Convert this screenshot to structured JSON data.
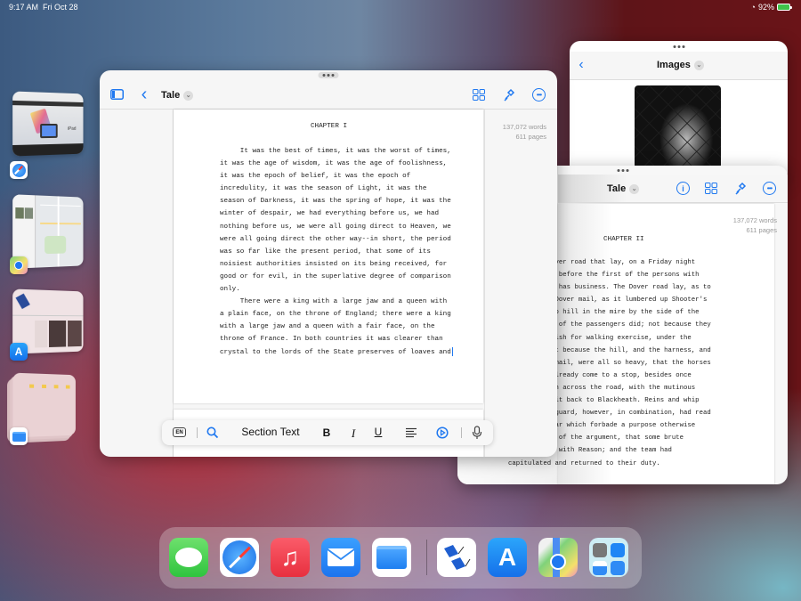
{
  "status_bar": {
    "time": "9:17 AM",
    "date": "Fri Oct 28",
    "wifi_icon": "wifi-icon",
    "battery_percent": "92%",
    "battery_level": 0.92,
    "battery_charging": true
  },
  "app_switcher": [
    {
      "app": "Safari",
      "icon": "safari-icon",
      "thumb_caption": "iPad"
    },
    {
      "app": "Maps",
      "icon": "maps-icon"
    },
    {
      "app": "App Store",
      "icon": "app-store-icon"
    },
    {
      "app": "Files",
      "icon": "files-icon"
    }
  ],
  "main_window": {
    "title": "Tale",
    "toolbar_icons": [
      "sidebar-icon",
      "back-chevron-icon",
      "grid-icon",
      "brush-icon",
      "more-icon"
    ],
    "stats": {
      "words": "137,072 words",
      "pages": "611 pages"
    },
    "chapter_title": "CHAPTER I",
    "lines": [
      "     It was the best of times, it was the worst of times,",
      "it was the age of wisdom, it was the age of foolishness,",
      "it was the epoch of belief, it was the epoch of",
      "incredulity, it was the season of Light, it was the",
      "season of Darkness, it was the spring of hope, it was the",
      "winter of despair, we had everything before us, we had",
      "nothing before us, we were all going direct to Heaven, we",
      "were all going direct the other way--in short, the period",
      "was so far like the present period, that some of its",
      "noisiest authorities insisted on its being received, for",
      "good or for evil, in the superlative degree of comparison",
      "only.",
      "     There were a king with a large jaw and a queen with",
      "a plain face, on the throne of England; there were a king",
      "with a large jaw and a queen with a fair face, on the",
      "throne of France. In both countries it was clearer than",
      "crystal to the lords of the State preserves of loaves and"
    ],
    "format_bar": {
      "language": "EN",
      "search_icon": "search-icon",
      "style_label": "Section Text",
      "bold": "B",
      "italic": "I",
      "underline": "U",
      "align_icon": "align-left-icon",
      "play_icon": "play-circle-icon",
      "mic_icon": "microphone-icon"
    }
  },
  "images_window": {
    "title": "Images",
    "back_icon": "back-chevron-icon",
    "image_description": "black-and-white portrait behind chain-link fence"
  },
  "secondary_window": {
    "title": "Tale",
    "toolbar_icons": [
      "info-icon",
      "grid-icon",
      "brush-icon",
      "more-icon"
    ],
    "stats": {
      "words": "137,072 words",
      "pages": "611 pages"
    },
    "chapter_title": "CHAPTER II",
    "lines": [
      "      the Dover road that lay, on a Friday night",
      "      ember, before the first of the persons with",
      "      istory has business. The Dover road lay, as to",
      "      l the Dover mail, as it lumbered up Shooter's",
      "      lked up hill in the mire by the side of the",
      "      e rest of the passengers did; not because they",
      "      st relish for walking exercise, under the",
      "      es, but because the hill, and the harness, and",
      "      d the mail, were all so heavy, that the horses",
      "      imes already come to a stop, besides once",
      "      e coach across the road, with the mutinous",
      "      aking it back to Blackheath. Reins and whip",
      "      n and guard, however, in combination, had read",
      "      e of war which forbade a purpose otherwise",
      "      favour of the argument, that some brute",
      "      endued with Reason; and the team had",
      "capitulated and returned to their duty."
    ]
  },
  "dock": {
    "apps": [
      {
        "name": "Messages",
        "color": "#4cd964"
      },
      {
        "name": "Safari",
        "color": "#ffffff"
      },
      {
        "name": "Music",
        "color": "#f0454f"
      },
      {
        "name": "Mail",
        "color": "#2f8bf5"
      },
      {
        "name": "Files",
        "color": "#ffffff"
      }
    ],
    "recent_apps": [
      {
        "name": "Final Draft",
        "color": "#ffffff"
      },
      {
        "name": "App Store",
        "color": "#1f86f5"
      },
      {
        "name": "Maps",
        "color": "#7fd27a"
      },
      {
        "name": "App Library",
        "color": "#cfeef5"
      }
    ]
  },
  "colors": {
    "accent": "#1f78f0",
    "window_bg": "#f6f6f6",
    "page_bg": "#ffffff"
  }
}
